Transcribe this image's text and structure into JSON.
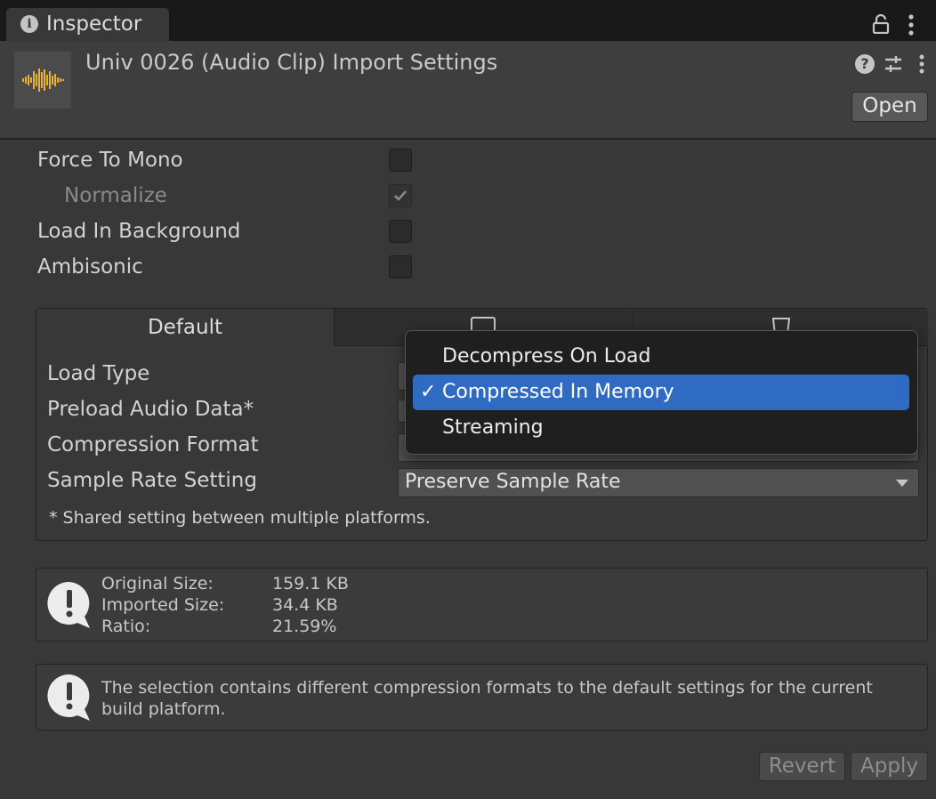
{
  "window": {
    "tab_title": "Inspector",
    "tab_icon": "info-icon"
  },
  "header": {
    "title": "Univ 0026 (Audio Clip) Import Settings",
    "open_label": "Open",
    "thumbnail": "audio-waveform-icon",
    "waveform_color": "#e8b22a"
  },
  "options": [
    {
      "label": "Force To Mono",
      "checked": false,
      "disabled": false
    },
    {
      "label": "Normalize",
      "checked": true,
      "disabled": true
    },
    {
      "label": "Load In Background",
      "checked": false,
      "disabled": false
    },
    {
      "label": "Ambisonic",
      "checked": false,
      "disabled": false
    }
  ],
  "platform": {
    "tabs": [
      {
        "label": "Default"
      },
      {
        "icon": "monitor-icon"
      },
      {
        "icon": "html5-icon"
      }
    ],
    "fields": [
      {
        "label": "Load Type",
        "value": "Compressed In Memory"
      },
      {
        "label": "Preload Audio Data*",
        "value": ""
      },
      {
        "label": "Compression Format",
        "value": ""
      },
      {
        "label": "Sample Rate Setting",
        "value": "Preserve Sample Rate"
      }
    ],
    "note": "* Shared setting between multiple platforms."
  },
  "stats": {
    "rows": [
      {
        "label": "Original Size:",
        "value": "159.1 KB"
      },
      {
        "label": "Imported Size:",
        "value": "34.4 KB"
      },
      {
        "label": "Ratio:",
        "value": "21.59%"
      }
    ]
  },
  "warning": {
    "text": "The selection contains different compression formats to the default settings for the current build platform."
  },
  "dropdown": {
    "items": [
      {
        "label": "Decompress On Load",
        "selected": false
      },
      {
        "label": "Compressed In Memory",
        "selected": true
      },
      {
        "label": "Streaming",
        "selected": false
      }
    ],
    "check_glyph": "✓",
    "accent": "#2f6ac3"
  },
  "footer": {
    "revert_label": "Revert",
    "apply_label": "Apply"
  }
}
